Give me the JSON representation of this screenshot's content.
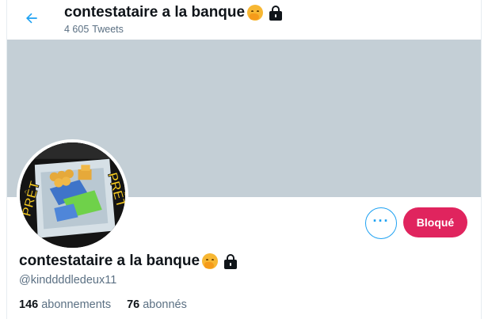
{
  "header": {
    "back_icon": "arrow-left-icon",
    "title": "contestataire a la banque",
    "tweet_count": "4 605",
    "tweet_label": "Tweets"
  },
  "profile": {
    "name": "contestataire a la banque",
    "handle": "@kinddddledeux11",
    "avatar_text_left": "PRÊT",
    "avatar_text_right": "PRÊT"
  },
  "actions": {
    "more_label": "···",
    "blocked_label": "Bloqué"
  },
  "stats": {
    "following_count": "146",
    "following_label": "abonnements",
    "followers_count": "76",
    "followers_label": "abonnés"
  },
  "colors": {
    "accent": "#1da1f2",
    "blocked": "#e0245e",
    "banner": "#c4cfd6",
    "secondary_text": "#5b7083"
  }
}
